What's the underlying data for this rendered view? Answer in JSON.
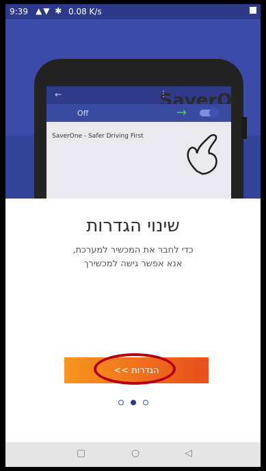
{
  "status": {
    "time": "9:39",
    "speed": "0.08 K/s",
    "icons": "▲▼ ✱"
  },
  "hero": {
    "app_title": "SaverOne",
    "toggle_label": "Off",
    "app_text": "SaverOne - Safer Driving First"
  },
  "main": {
    "title": "שינוי הגדרות",
    "line1": "כדי לחבר את המכשיר למערכת,",
    "line2": "אנא אפשר גישה למכשירך",
    "button_label": "הגדרות >>"
  },
  "pager": {
    "pages": 3,
    "active_index": 1
  },
  "navbar": {
    "recent": "recent-apps",
    "home": "home",
    "back": "back"
  },
  "colors": {
    "hero_bg": "#3a4ca8",
    "accent_start": "#f7961f",
    "accent_end": "#e94e1b",
    "highlight_ring": "#b3000f"
  }
}
